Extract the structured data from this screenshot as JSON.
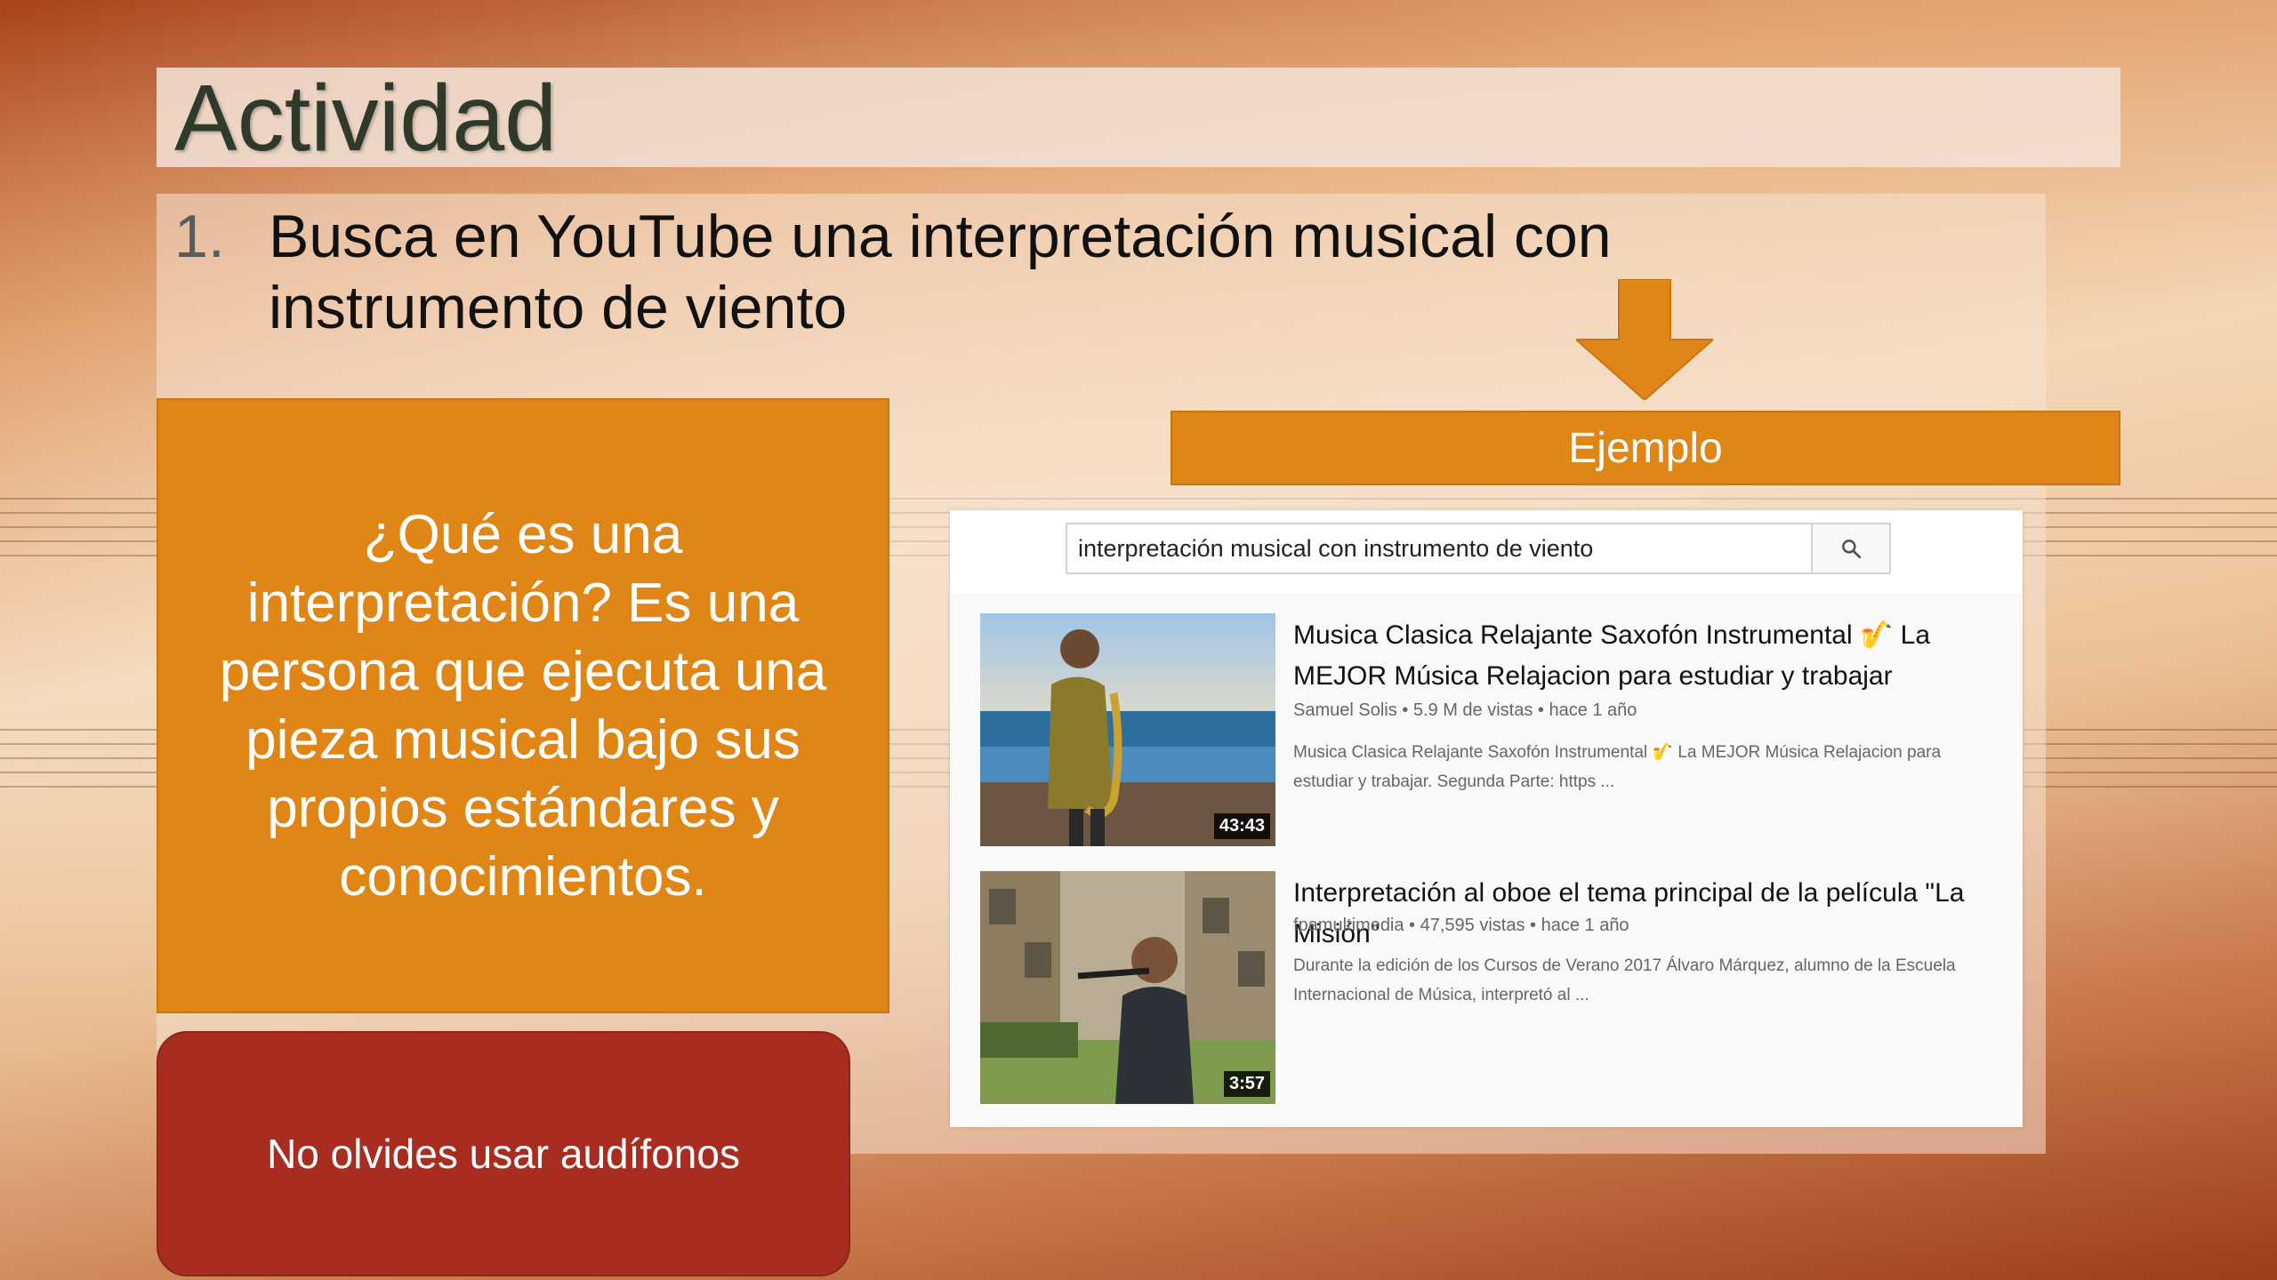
{
  "slide": {
    "title": "Actividad",
    "step_number": "1.",
    "step_text": "Busca en YouTube una interpretación musical con instrumento de viento"
  },
  "definition_box": {
    "text": "¿Qué es una interpretación? Es una persona que ejecuta una pieza musical bajo sus propios estándares y conocimientos."
  },
  "reminder_box": {
    "text": "No olvides usar audífonos"
  },
  "example_label": "Ejemplo",
  "youtube": {
    "search_value": "interpretación musical con instrumento de viento",
    "search_icon": "search-icon",
    "results": [
      {
        "title": "Musica Clasica Relajante Saxofón Instrumental 🎷 La MEJOR Música Relajacion para estudiar y trabajar",
        "channel": "Samuel Solis",
        "views": "5.9 M de vistas",
        "age": "hace 1 año",
        "meta": "Samuel Solis • 5.9 M de vistas • hace 1 año",
        "description": "Musica Clasica Relajante Saxofón Instrumental 🎷 La MEJOR Música Relajacion para estudiar y trabajar. Segunda Parte: https ...",
        "duration": "43:43"
      },
      {
        "title": "Interpretación al oboe el tema principal de la película \"La Misión\"",
        "channel": "fpamultimedia",
        "views": "47,595 vistas",
        "age": "hace 1 año",
        "meta": "fpamultimedia • 47,595 vistas • hace 1 año",
        "description": "Durante la edición de los Cursos de Verano 2017 Álvaro Márquez, alumno de la Escuela Internacional de Música, interpretó al ...",
        "duration": "3:57"
      }
    ]
  },
  "colors": {
    "accent_orange": "#e08616",
    "reminder_red": "#a82d20",
    "title_text": "#2f3a2a"
  }
}
